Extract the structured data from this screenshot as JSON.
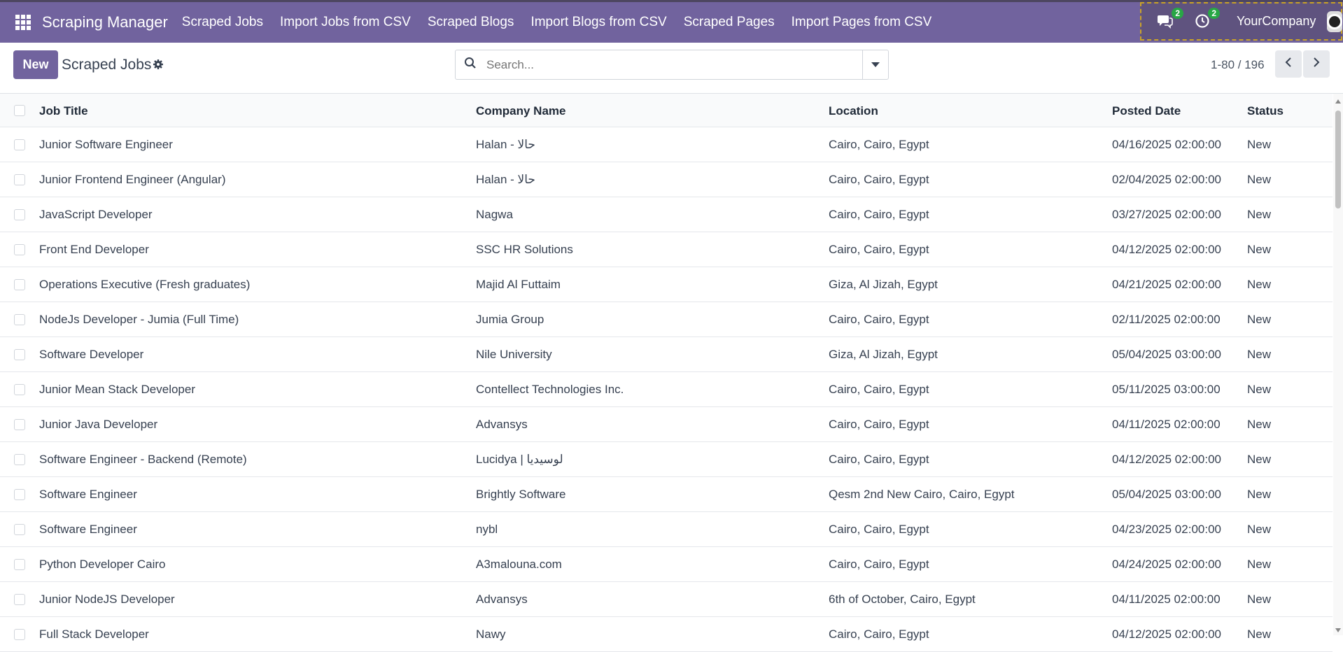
{
  "navbar": {
    "app_name": "Scraping Manager",
    "menu": [
      "Scraped Jobs",
      "Import Jobs from CSV",
      "Scraped Blogs",
      "Import Blogs from CSV",
      "Scraped Pages",
      "Import Pages from CSV"
    ],
    "messages_count": "2",
    "activities_count": "2",
    "company": "YourCompany"
  },
  "control_panel": {
    "new_label": "New",
    "title": "Scraped Jobs",
    "search_placeholder": "Search...",
    "pager": "1-80 / 196"
  },
  "table": {
    "headers": [
      "Job Title",
      "Company Name",
      "Location",
      "Posted Date",
      "Status"
    ],
    "rows": [
      [
        "Junior Software Engineer",
        "Halan - حالا",
        "Cairo, Cairo, Egypt",
        "04/16/2025 02:00:00",
        "New"
      ],
      [
        "Junior Frontend Engineer (Angular)",
        "Halan - حالا",
        "Cairo, Cairo, Egypt",
        "02/04/2025 02:00:00",
        "New"
      ],
      [
        "JavaScript Developer",
        "Nagwa",
        "Cairo, Cairo, Egypt",
        "03/27/2025 02:00:00",
        "New"
      ],
      [
        "Front End Developer",
        "SSC HR Solutions",
        "Cairo, Cairo, Egypt",
        "04/12/2025 02:00:00",
        "New"
      ],
      [
        "Operations Executive (Fresh graduates)",
        "Majid Al Futtaim",
        "Giza, Al Jizah, Egypt",
        "04/21/2025 02:00:00",
        "New"
      ],
      [
        "NodeJs Developer - Jumia (Full Time)",
        "Jumia Group",
        "Cairo, Cairo, Egypt",
        "02/11/2025 02:00:00",
        "New"
      ],
      [
        "Software Developer",
        "Nile University",
        "Giza, Al Jizah, Egypt",
        "05/04/2025 03:00:00",
        "New"
      ],
      [
        "Junior Mean Stack Developer",
        "Contellect Technologies Inc.",
        "Cairo, Cairo, Egypt",
        "05/11/2025 03:00:00",
        "New"
      ],
      [
        "Junior Java Developer",
        "Advansys",
        "Cairo, Cairo, Egypt",
        "04/11/2025 02:00:00",
        "New"
      ],
      [
        "Software Engineer - Backend (Remote)",
        "Lucidya | لوسيديا",
        "Cairo, Cairo, Egypt",
        "04/12/2025 02:00:00",
        "New"
      ],
      [
        "Software Engineer",
        "Brightly Software",
        "Qesm 2nd New Cairo, Cairo, Egypt",
        "05/04/2025 03:00:00",
        "New"
      ],
      [
        "Software Engineer",
        "nybl",
        "Cairo, Cairo, Egypt",
        "04/23/2025 02:00:00",
        "New"
      ],
      [
        "Python Developer Cairo",
        "A3malouna.com",
        "Cairo, Cairo, Egypt",
        "04/24/2025 02:00:00",
        "New"
      ],
      [
        "Junior NodeJS Developer",
        "Advansys",
        "6th of October, Cairo, Egypt",
        "04/11/2025 02:00:00",
        "New"
      ],
      [
        "Full Stack Developer",
        "Nawy",
        "Cairo, Cairo, Egypt",
        "04/12/2025 02:00:00",
        "New"
      ]
    ]
  },
  "colors": {
    "navbar": "#71639e",
    "primary_button": "#71639e",
    "badge": "#28a745"
  }
}
